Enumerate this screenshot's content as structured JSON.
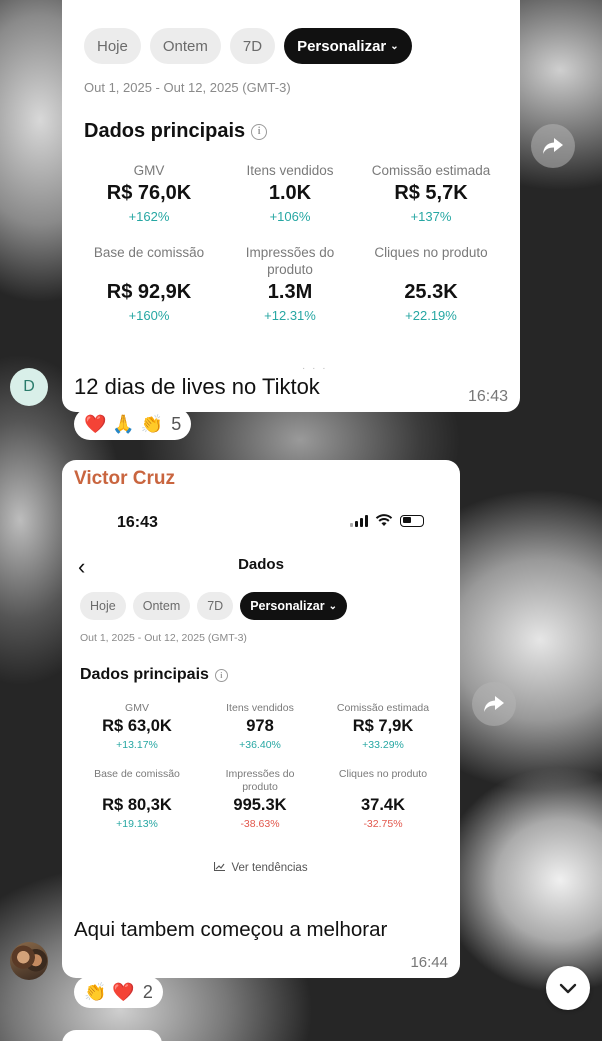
{
  "message1": {
    "chips": [
      "Hoje",
      "Ontem",
      "7D",
      "Personalizar"
    ],
    "date_range": "Out 1, 2025 - Out 12, 2025 (GMT-3)",
    "section_title": "Dados principais",
    "metrics": [
      {
        "label": "GMV",
        "value": "R$ 76,0K",
        "delta": "+162%",
        "trend": "up"
      },
      {
        "label": "Itens vendidos",
        "value": "1.0K",
        "delta": "+106%",
        "trend": "up"
      },
      {
        "label": "Comissão estimada",
        "value": "R$ 5,7K",
        "delta": "+137%",
        "trend": "up"
      },
      {
        "label": "Base de comissão",
        "value": "R$ 92,9K",
        "delta": "+160%",
        "trend": "up"
      },
      {
        "label": "Impressões do produto",
        "value": "1.3M",
        "delta": "+12.31%",
        "trend": "up"
      },
      {
        "label": "Cliques no produto",
        "value": "25.3K",
        "delta": "+22.19%",
        "trend": "up"
      }
    ],
    "caption": "12 dias de lives no Tiktok",
    "time": "16:43",
    "avatar_initial": "D",
    "reactions": {
      "emojis": [
        "❤️",
        "🙏",
        "👏"
      ],
      "count": "5"
    }
  },
  "message2": {
    "sender": "Victor Cruz",
    "status_time": "16:43",
    "page_title": "Dados",
    "chips": [
      "Hoje",
      "Ontem",
      "7D",
      "Personalizar"
    ],
    "date_range": "Out 1, 2025 - Out 12, 2025 (GMT-3)",
    "section_title": "Dados principais",
    "metrics": [
      {
        "label": "GMV",
        "value": "R$ 63,0K",
        "delta": "+13.17%",
        "trend": "up"
      },
      {
        "label": "Itens vendidos",
        "value": "978",
        "delta": "+36.40%",
        "trend": "up"
      },
      {
        "label": "Comissão estimada",
        "value": "R$ 7,9K",
        "delta": "+33.29%",
        "trend": "up"
      },
      {
        "label": "Base de comissão",
        "value": "R$ 80,3K",
        "delta": "+19.13%",
        "trend": "up"
      },
      {
        "label": "Impressões do produto",
        "value": "995.3K",
        "delta": "-38.63%",
        "trend": "down"
      },
      {
        "label": "Cliques no produto",
        "value": "37.4K",
        "delta": "-32.75%",
        "trend": "down"
      }
    ],
    "trends_link": "Ver tendências",
    "caption": "Aqui tambem começou a melhorar",
    "time": "16:44",
    "reactions": {
      "emojis": [
        "👏",
        "❤️"
      ],
      "count": "2"
    }
  },
  "colors": {
    "positive_delta": "#27a7a3",
    "negative_delta": "#e2574c",
    "sender_name": "#c9653f",
    "active_chip": "#111111"
  },
  "icons": {
    "share": "share-forward-icon",
    "scroll": "chevron-down-icon",
    "info": "info-icon",
    "back": "chevron-left-icon"
  }
}
